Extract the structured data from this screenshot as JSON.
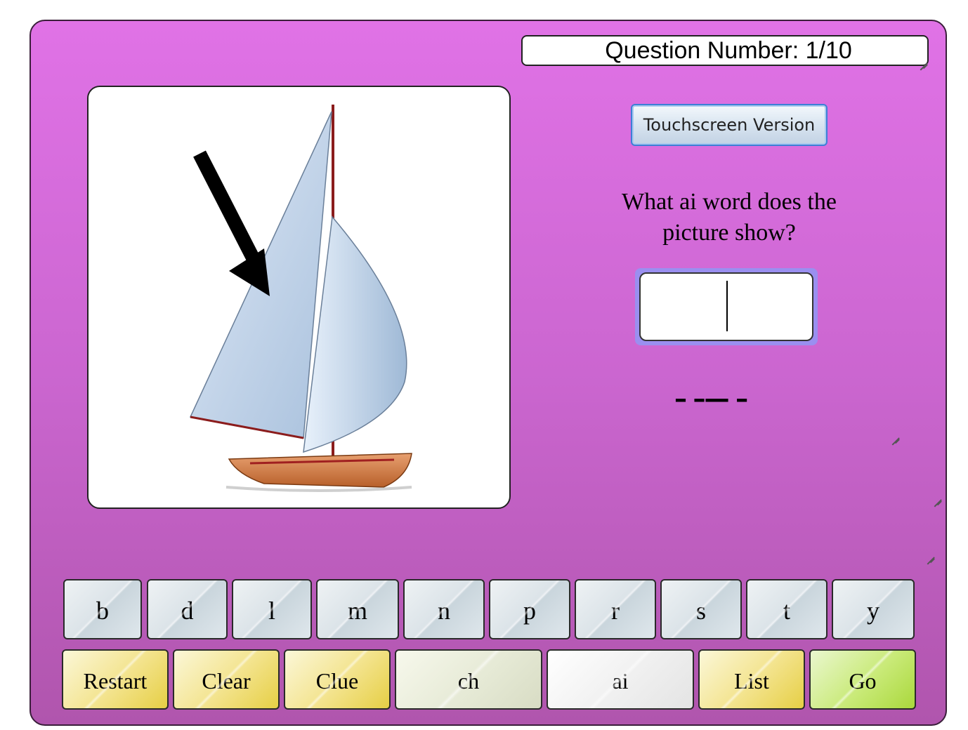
{
  "header": {
    "question_number": "Question Number: 1/10"
  },
  "touchscreen_button": "Touchscreen Version",
  "question": {
    "line1": "What ai word does the",
    "line2": "picture show?"
  },
  "answer": {
    "value": ""
  },
  "blanks": "– –— –",
  "letters": [
    "b",
    "d",
    "l",
    "m",
    "n",
    "p",
    "r",
    "s",
    "t",
    "y"
  ],
  "actions": {
    "restart": "Restart",
    "clear": "Clear",
    "clue": "Clue",
    "ch": "ch",
    "ai": "ai",
    "list": "List",
    "go": "Go"
  },
  "colors": {
    "panel_top": "#e072e6",
    "panel_bottom": "#b055ad",
    "answer_border": "#9a8ff0",
    "touch_button_border": "#3d7fd6"
  },
  "picture": {
    "icon": "sailboat-with-arrow-icon"
  }
}
